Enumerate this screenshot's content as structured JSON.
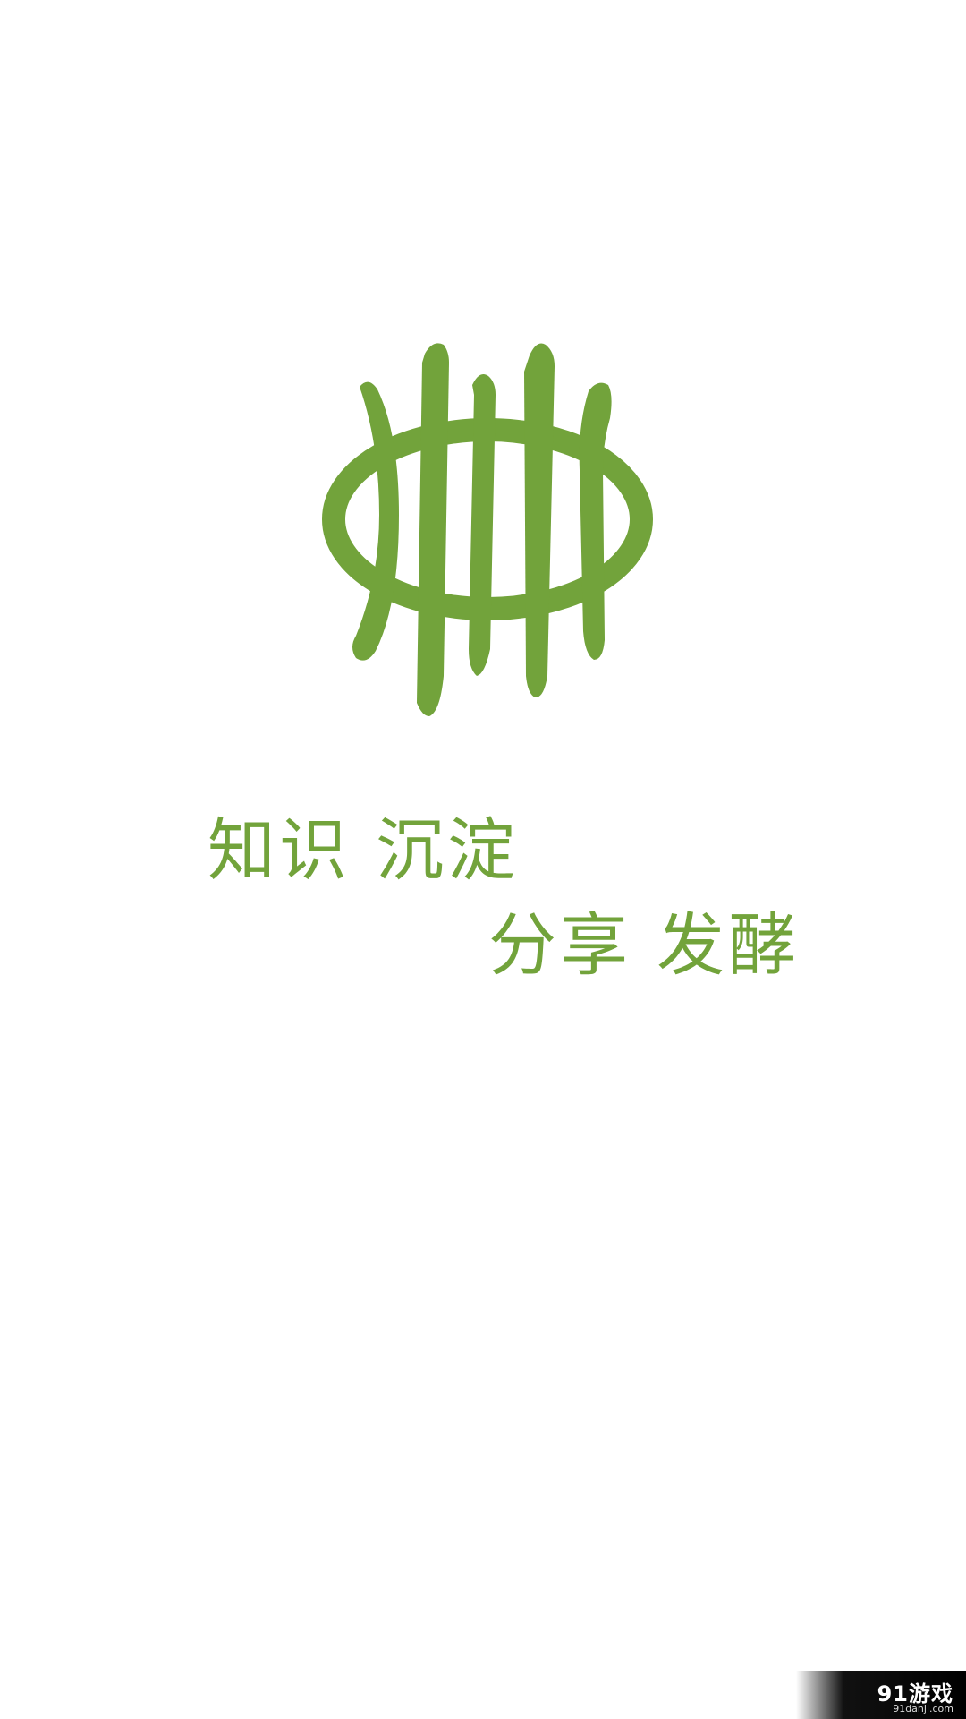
{
  "brand": {
    "accent_color": "#72a33b",
    "logo_icon": "fence-ellipse-logo-icon"
  },
  "slogan": {
    "line1": "知识 沉淀",
    "line2": "分享 发酵"
  },
  "watermark": {
    "logo": "91游戏",
    "url": "91danji.com"
  }
}
